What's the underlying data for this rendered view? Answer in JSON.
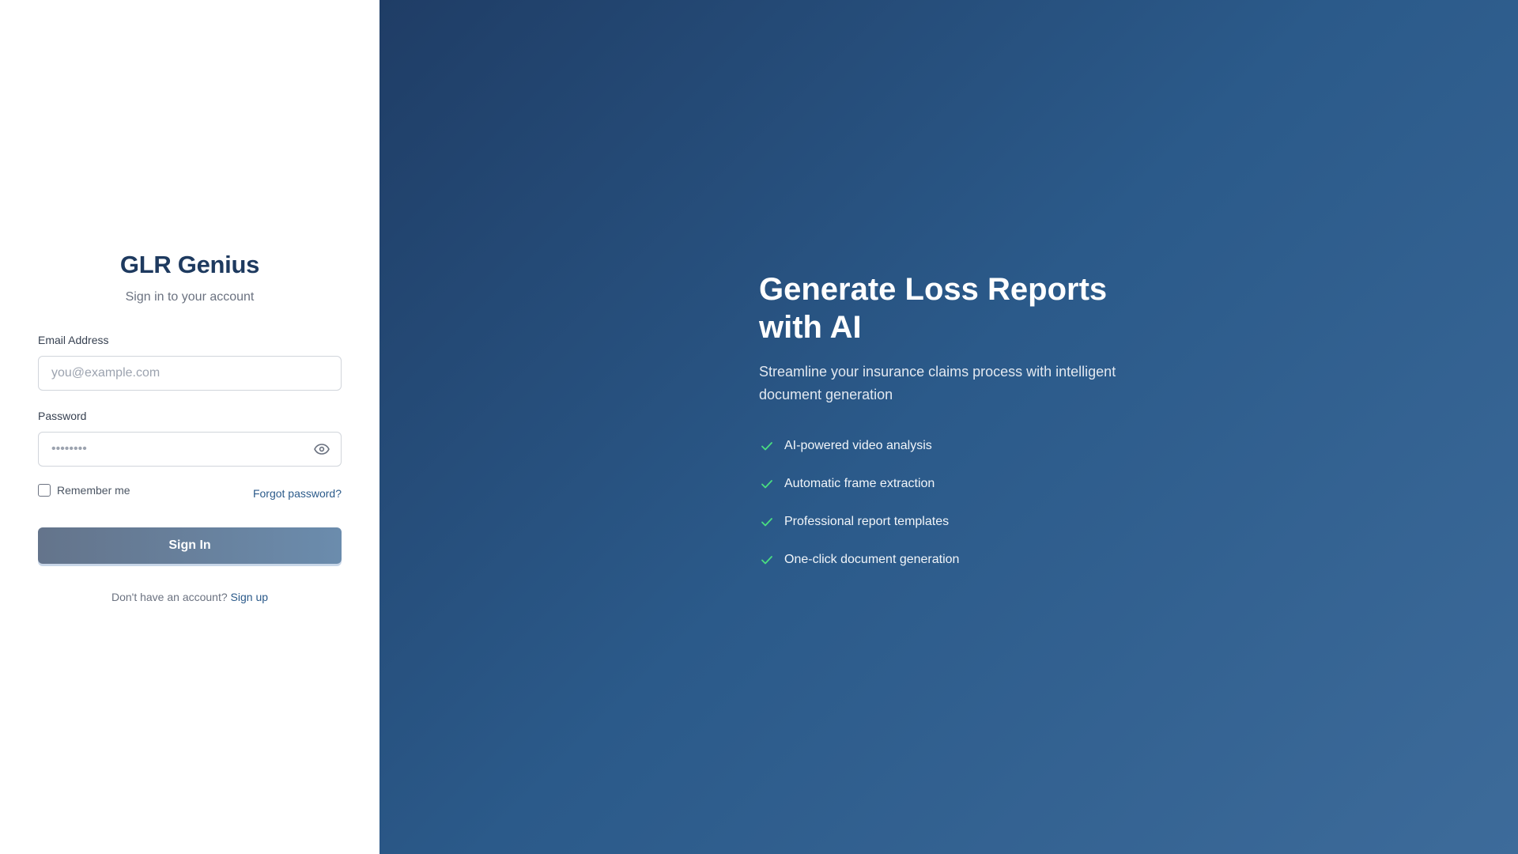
{
  "login": {
    "app_name": "GLR Genius",
    "subtitle": "Sign in to your account",
    "email_label": "Email Address",
    "email_placeholder": "you@example.com",
    "email_value": "",
    "password_label": "Password",
    "password_placeholder": "••••••••",
    "password_value": "",
    "show_password_icon": "eye-icon",
    "remember_label": "Remember me",
    "remember_checked": false,
    "forgot_label": "Forgot password?",
    "signin_label": "Sign In",
    "signup_prompt": "Don't have an account?",
    "signup_label": "Sign up"
  },
  "hero": {
    "title": "Generate Loss Reports with AI",
    "description": "Streamline your insurance claims process with intelligent document generation",
    "features": [
      "AI-powered video analysis",
      "Automatic frame extraction",
      "Professional report templates",
      "One-click document generation"
    ],
    "feature_icon": "check-icon"
  },
  "colors": {
    "brand": "#1e3a5f",
    "link": "#2b5a8a",
    "check": "#4ade80",
    "panel_gradient_start": "#1f3d66",
    "panel_gradient_end": "#3d6b9a"
  }
}
